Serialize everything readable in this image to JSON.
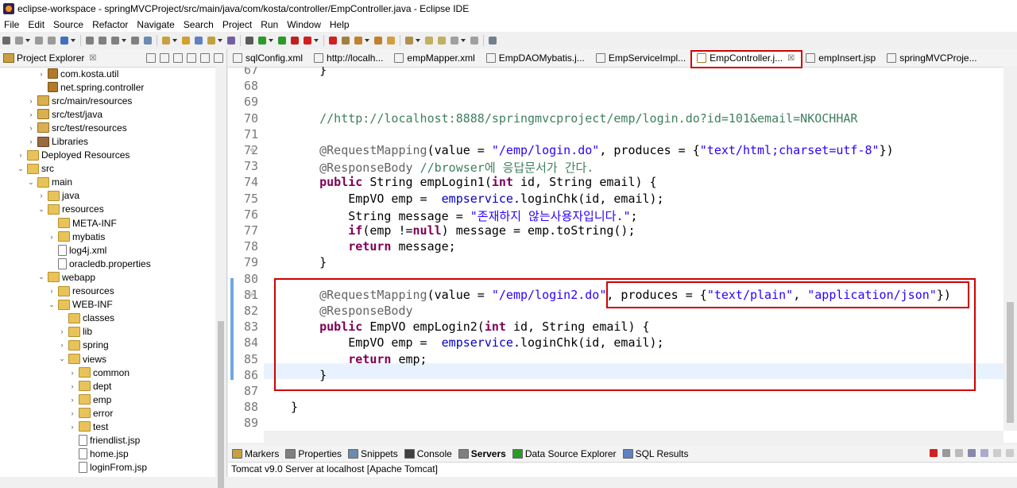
{
  "window": {
    "title": "eclipse-workspace - springMVCProject/src/main/java/com/kosta/controller/EmpController.java - Eclipse IDE"
  },
  "menu": [
    "File",
    "Edit",
    "Source",
    "Refactor",
    "Navigate",
    "Search",
    "Project",
    "Run",
    "Window",
    "Help"
  ],
  "explorer": {
    "title": "Project Explorer",
    "close": "☒",
    "items": [
      {
        "label": "com.kosta.util",
        "twisty": "›",
        "icon": "package-icon"
      },
      {
        "label": "net.spring.controller",
        "twisty": "",
        "icon": "package-icon"
      },
      {
        "label": "src/main/resources",
        "twisty": "›",
        "icon": "source-folder-icon"
      },
      {
        "label": "src/test/java",
        "twisty": "›",
        "icon": "source-folder-icon"
      },
      {
        "label": "src/test/resources",
        "twisty": "›",
        "icon": "source-folder-icon"
      },
      {
        "label": "Libraries",
        "twisty": "›",
        "icon": "library-icon"
      },
      {
        "label": "Deployed Resources",
        "twisty": "›",
        "icon": "folder-icon"
      },
      {
        "label": "src",
        "twisty": "⌄",
        "icon": "folder-icon"
      },
      {
        "label": "main",
        "twisty": "⌄",
        "icon": "folder-icon"
      },
      {
        "label": "java",
        "twisty": "›",
        "icon": "folder-icon"
      },
      {
        "label": "resources",
        "twisty": "⌄",
        "icon": "folder-icon"
      },
      {
        "label": "META-INF",
        "twisty": "",
        "icon": "folder-icon"
      },
      {
        "label": "mybatis",
        "twisty": "›",
        "icon": "folder-icon"
      },
      {
        "label": "log4j.xml",
        "twisty": "",
        "icon": "file-icon"
      },
      {
        "label": "oracledb.properties",
        "twisty": "",
        "icon": "file-icon"
      },
      {
        "label": "webapp",
        "twisty": "⌄",
        "icon": "folder-icon"
      },
      {
        "label": "resources",
        "twisty": "›",
        "icon": "folder-icon"
      },
      {
        "label": "WEB-INF",
        "twisty": "⌄",
        "icon": "folder-icon"
      },
      {
        "label": "classes",
        "twisty": "",
        "icon": "folder-icon"
      },
      {
        "label": "lib",
        "twisty": "›",
        "icon": "folder-icon"
      },
      {
        "label": "spring",
        "twisty": "›",
        "icon": "folder-icon"
      },
      {
        "label": "views",
        "twisty": "⌄",
        "icon": "folder-icon"
      },
      {
        "label": "common",
        "twisty": "›",
        "icon": "folder-icon"
      },
      {
        "label": "dept",
        "twisty": "›",
        "icon": "folder-icon"
      },
      {
        "label": "emp",
        "twisty": "›",
        "icon": "folder-icon"
      },
      {
        "label": "error",
        "twisty": "›",
        "icon": "folder-icon"
      },
      {
        "label": "test",
        "twisty": "›",
        "icon": "folder-icon"
      },
      {
        "label": "friendlist.jsp",
        "twisty": "",
        "icon": "file-icon"
      },
      {
        "label": "home.jsp",
        "twisty": "",
        "icon": "file-icon"
      },
      {
        "label": "loginFrom.jsp",
        "twisty": "",
        "icon": "file-icon"
      }
    ]
  },
  "editor": {
    "tabs": [
      {
        "label": "sqlConfig.xml",
        "active": false
      },
      {
        "label": "http://localh...",
        "active": false
      },
      {
        "label": "empMapper.xml",
        "active": false
      },
      {
        "label": "EmpDAOMybatis.j...",
        "active": false
      },
      {
        "label": "EmpServiceImpl...",
        "active": false
      },
      {
        "label": "EmpController.j...",
        "active": true
      },
      {
        "label": "empInsert.jsp",
        "active": false
      },
      {
        "label": "springMVCProje...",
        "active": false
      }
    ],
    "tab_close": "☒",
    "lines": [
      {
        "n": "67",
        "code": "    }"
      },
      {
        "n": "68",
        "code": ""
      },
      {
        "n": "69",
        "code": ""
      },
      {
        "n": "70",
        "code": "    //http://localhost:8888/springmvcproject/emp/login.do?id=101&email=NKOCHHAR"
      },
      {
        "n": "71",
        "code": ""
      },
      {
        "n": "72",
        "code": "    @RequestMapping(value = \"/emp/login.do\", produces = {\"text/html;charset=utf-8\"})"
      },
      {
        "n": "73",
        "code": "    @ResponseBody //browser에 응답문서가 간다."
      },
      {
        "n": "74",
        "code": "    public String empLogin1(int id, String email) {"
      },
      {
        "n": "75",
        "code": "        EmpVO emp =  empservice.loginChk(id, email);"
      },
      {
        "n": "76",
        "code": "        String message = \"존재하지 않는사용자입니다.\";"
      },
      {
        "n": "77",
        "code": "        if(emp !=null) message = emp.toString();"
      },
      {
        "n": "78",
        "code": "        return message;"
      },
      {
        "n": "79",
        "code": "    }"
      },
      {
        "n": "80",
        "code": ""
      },
      {
        "n": "81",
        "code": "    @RequestMapping(value = \"/emp/login2.do\", produces = {\"text/plain\", \"application/json\"})"
      },
      {
        "n": "82",
        "code": "    @ResponseBody"
      },
      {
        "n": "83",
        "code": "    public EmpVO empLogin2(int id, String email) {"
      },
      {
        "n": "84",
        "code": "        EmpVO emp =  empservice.loginChk(id, email);"
      },
      {
        "n": "85",
        "code": "        return emp;"
      },
      {
        "n": "86",
        "code": "    }"
      },
      {
        "n": "87",
        "code": ""
      },
      {
        "n": "88",
        "code": "}"
      },
      {
        "n": "89",
        "code": ""
      }
    ]
  },
  "bottom": {
    "tabs": [
      {
        "label": "Markers",
        "active": false
      },
      {
        "label": "Properties",
        "active": false
      },
      {
        "label": "Snippets",
        "active": false
      },
      {
        "label": "Console",
        "active": false
      },
      {
        "label": "Servers",
        "active": true
      },
      {
        "label": "Data Source Explorer",
        "active": false
      },
      {
        "label": "SQL Results",
        "active": false
      }
    ],
    "server": "Tomcat v9.0 Server at localhost [Apache Tomcat]"
  },
  "colors": {
    "highlight": "#d00000",
    "keyword": "#7f0055",
    "string": "#2a00ff",
    "comment": "#3f7f5f",
    "annotation": "#646464",
    "field": "#0000c0"
  }
}
